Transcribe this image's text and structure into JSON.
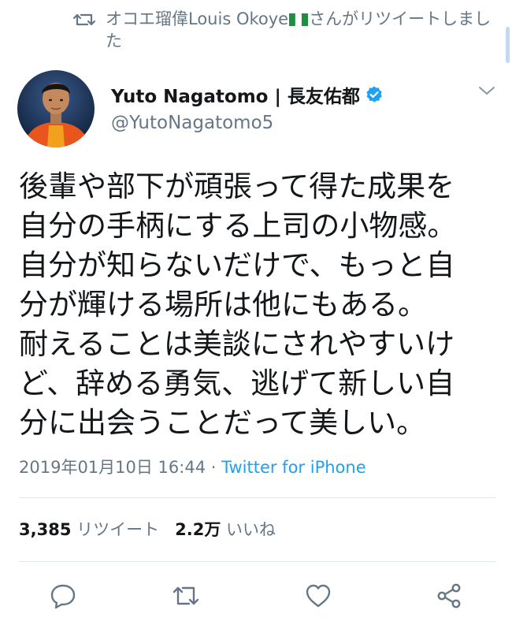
{
  "retweet_context": {
    "text_before_flag": "オコエ瑠偉Louis Okoye",
    "text_after_flag": "さんがリツイートしました",
    "flag_icon": "nigeria-flag-icon",
    "retweet_icon": "retweet-icon"
  },
  "author": {
    "display_name": "Yuto Nagatomo | 長友佑都",
    "handle": "@YutoNagatomo5",
    "verified_icon": "verified-badge-icon"
  },
  "tweet": {
    "lines": [
      "後輩や部下が頑張って得た成果を",
      "自分の手柄にする上司の小物感。",
      "自分が知らないだけで、もっと自",
      "分が輝ける場所は他にもある。",
      "耐えることは美談にされやすいけ",
      "ど、辞める勇気、逃げて新しい自",
      "分に出会うことだって美しい。"
    ],
    "timestamp": "2019年01月10日 16:44",
    "separator": " · ",
    "source": "Twitter for iPhone"
  },
  "stats": {
    "retweet_count": "3,385",
    "retweet_label": "リツイート",
    "like_count": "2.2万",
    "like_label": "いいね"
  },
  "actions": [
    "reply-icon",
    "retweet-icon",
    "like-icon",
    "share-icon"
  ],
  "colors": {
    "accent": "#1da1f2",
    "text": "#14171a",
    "secondary": "#657786",
    "divider": "#e1e8ed"
  }
}
